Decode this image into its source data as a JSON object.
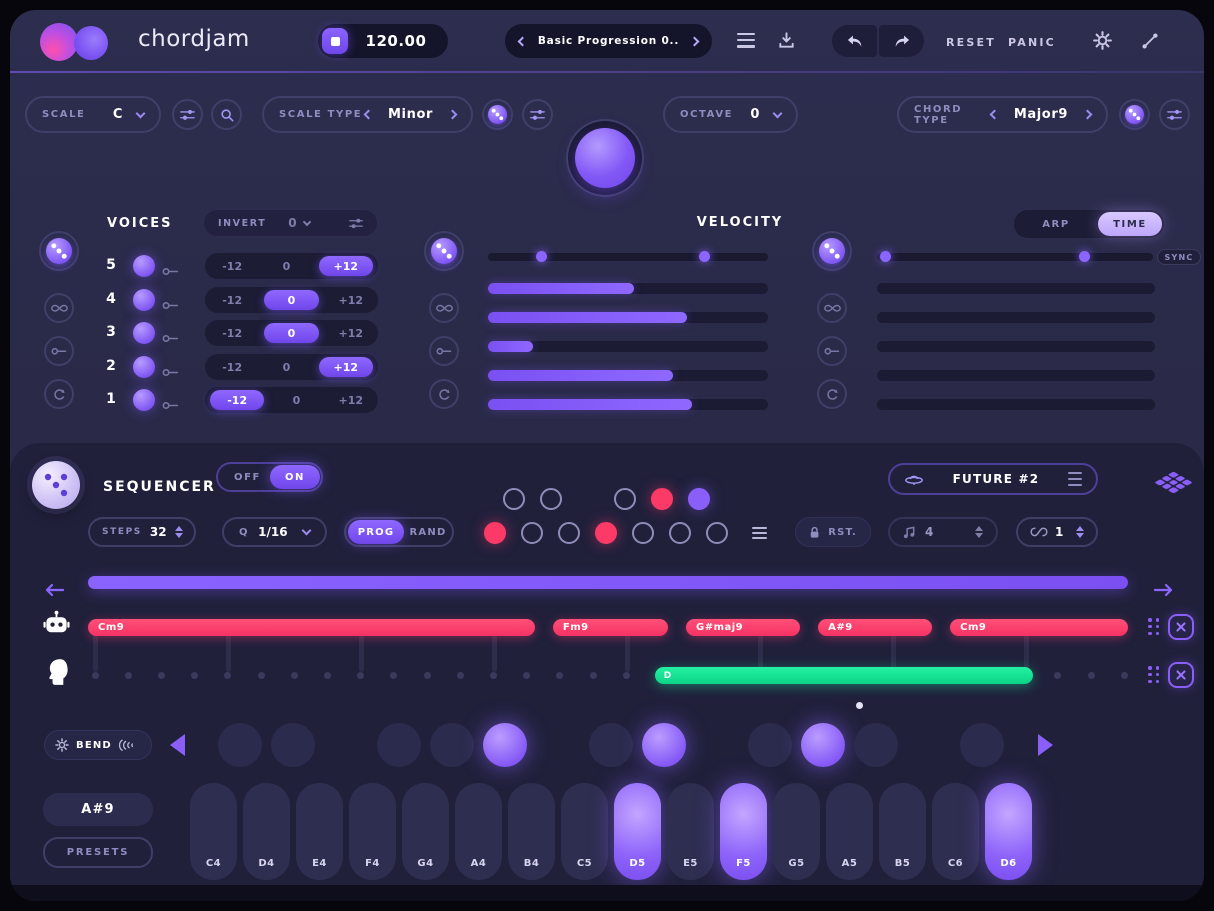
{
  "colors": {
    "accent": "#7c5cff",
    "accent_light": "#c9b6fe",
    "pink": "#fb3a68",
    "green": "#14e392",
    "background": "#2a2a49",
    "panel": "#20203b"
  },
  "icons": {
    "stop": "square",
    "menu": "hamburger",
    "save": "download-tray",
    "undo": "curved-arrow-left",
    "redo": "curved-arrow-right",
    "settings": "gear",
    "midi": "patch-cable",
    "randomize": "dice-sphere",
    "repeat": "infinity",
    "link": "chain-link",
    "retrigger": "refresh-arrow",
    "filter": "sliders",
    "find": "magnifier",
    "sequencer_preset": "ufo",
    "grid": "rubik-grid",
    "hold": "lock",
    "rate": "music-note",
    "loop": "infinity-arrow",
    "chord_track": "robot-head",
    "melody_track": "head-silhouette",
    "remove": "x-cross",
    "bend": "wave-arcs"
  },
  "topbar": {
    "app_name": "chordjam",
    "bpm": "120.00",
    "preset": "Basic Progression 0..",
    "reset_label": "RESET",
    "panic_label": "PANIC"
  },
  "scale_row": {
    "scale_label": "SCALE",
    "scale_value": "C",
    "scale_type_label": "SCALE TYPE",
    "scale_type_value": "Minor",
    "octave_label": "OCTAVE",
    "octave_value": "0",
    "chord_type_label": "CHORD TYPE",
    "chord_type_value": "Major9"
  },
  "voices": {
    "title": "VOICES",
    "invert_label": "INVERT",
    "invert_value": "0",
    "options": [
      "-12",
      "0",
      "+12"
    ],
    "rows": [
      {
        "num": "5",
        "on": true,
        "active": "+12"
      },
      {
        "num": "4",
        "on": true,
        "active": "0"
      },
      {
        "num": "3",
        "on": true,
        "active": "0"
      },
      {
        "num": "2",
        "on": true,
        "active": "+12"
      },
      {
        "num": "1",
        "on": true,
        "active": "-12"
      }
    ]
  },
  "velocity": {
    "title": "VELOCITY",
    "range_handles": [
      0.19,
      0.77
    ],
    "bars": [
      0.52,
      0.71,
      0.16,
      0.66,
      0.73
    ]
  },
  "arp_time": {
    "arp_label": "ARP",
    "time_label": "TIME",
    "active_tab": "TIME",
    "sync_label": "SYNC",
    "range_handles": [
      0.03,
      0.75
    ],
    "bars": [
      0,
      0,
      0,
      0,
      0
    ]
  },
  "sequencer": {
    "title": "SEQUENCER",
    "off_label": "OFF",
    "on_label": "ON",
    "power": "ON",
    "preset_name": "FUTURE #2",
    "steps_label": "STEPS",
    "steps_value": "32",
    "quantize_label": "Q",
    "quantize_value": "1/16",
    "prog_label": "PROG",
    "rand_label": "RAND",
    "mode": "PROG",
    "rst_label": "RST.",
    "rate_value": "4",
    "loop_value": "1",
    "num_steps": 32,
    "step_dots": {
      "row1": [
        "outline",
        "outline",
        null,
        "outline",
        "pink",
        "purple"
      ],
      "row2": [
        "pink",
        "outline",
        "outline",
        "pink",
        "outline",
        "outline",
        "outline"
      ]
    },
    "chords": [
      {
        "label": "Cm9",
        "start": 0.0,
        "width": 0.43
      },
      {
        "label": "Fm9",
        "start": 0.447,
        "width": 0.111
      },
      {
        "label": "G#maj9",
        "start": 0.575,
        "width": 0.11
      },
      {
        "label": "A#9",
        "start": 0.702,
        "width": 0.11
      },
      {
        "label": "Cm9",
        "start": 0.829,
        "width": 0.171
      }
    ],
    "melody": {
      "label": "D",
      "start": 0.545,
      "width": 0.364
    }
  },
  "keyboard": {
    "bend_label": "BEND",
    "chord_display": "A#9",
    "presets_label": "PRESETS",
    "keys": [
      {
        "label": "C4",
        "lit": false
      },
      {
        "label": "D4",
        "lit": false
      },
      {
        "label": "E4",
        "lit": false
      },
      {
        "label": "F4",
        "lit": false
      },
      {
        "label": "G4",
        "lit": false
      },
      {
        "label": "A4",
        "lit": false
      },
      {
        "label": "B4",
        "lit": false
      },
      {
        "label": "C5",
        "lit": false
      },
      {
        "label": "D5",
        "lit": true
      },
      {
        "label": "E5",
        "lit": false
      },
      {
        "label": "F5",
        "lit": true
      },
      {
        "label": "G5",
        "lit": false
      },
      {
        "label": "A5",
        "lit": false
      },
      {
        "label": "B5",
        "lit": false
      },
      {
        "label": "C6",
        "lit": false
      },
      {
        "label": "D6",
        "lit": true
      }
    ],
    "pads": [
      {
        "note": "C#4",
        "between": 0,
        "lit": false
      },
      {
        "note": "D#4",
        "between": 1,
        "lit": false
      },
      {
        "note": "F#4",
        "between": 3,
        "lit": false
      },
      {
        "note": "G#4",
        "between": 4,
        "lit": false
      },
      {
        "note": "A#4",
        "between": 5,
        "lit": true
      },
      {
        "note": "C#5",
        "between": 7,
        "lit": false
      },
      {
        "note": "D#5",
        "between": 8,
        "lit": true
      },
      {
        "note": "F#5",
        "between": 10,
        "lit": false
      },
      {
        "note": "G#5",
        "between": 11,
        "lit": true
      },
      {
        "note": "A#5",
        "between": 12,
        "lit": false
      },
      {
        "note": "C#6",
        "between": 14,
        "lit": false
      }
    ]
  }
}
